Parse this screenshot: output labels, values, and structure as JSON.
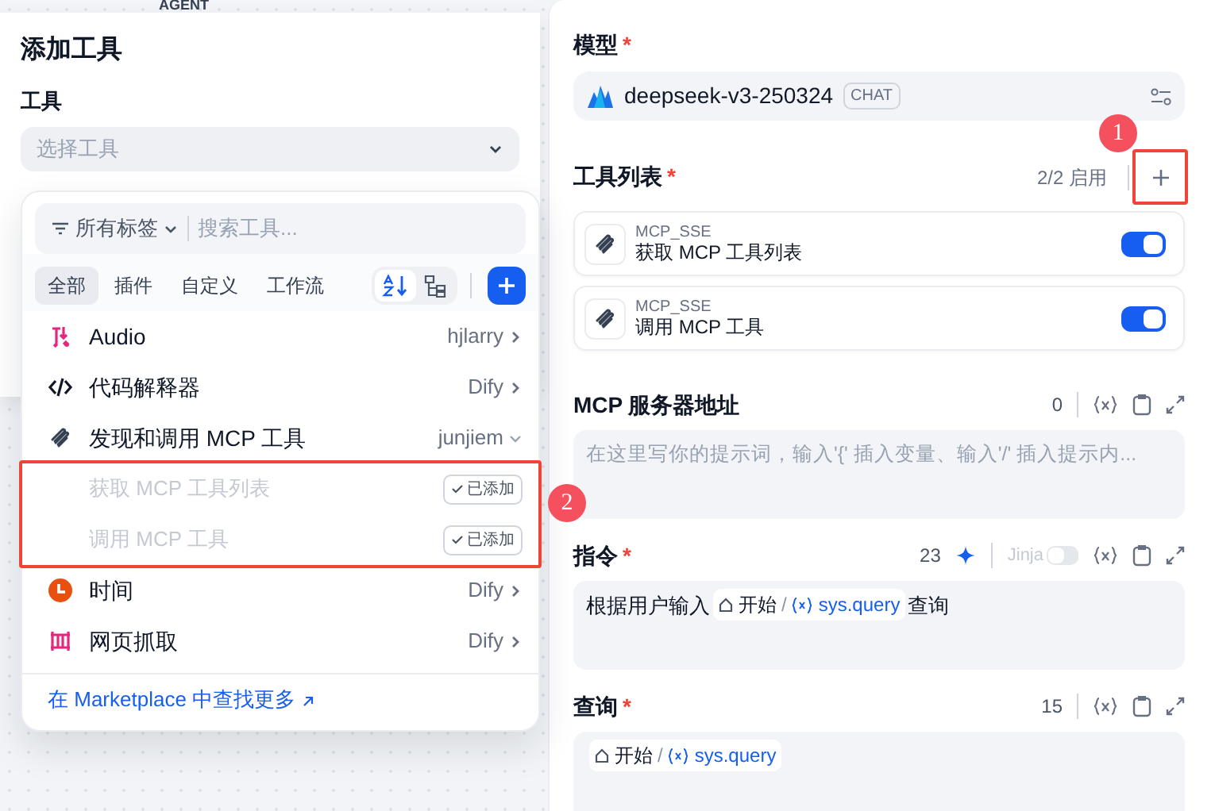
{
  "background_node": {
    "title": "AGENT"
  },
  "add_tool_panel": {
    "title": "添加工具",
    "field_label": "工具",
    "select": {
      "placeholder": "选择工具"
    },
    "dropdown": {
      "tag_filter": "所有标签",
      "search": {
        "placeholder": "搜索工具..."
      },
      "tabs": [
        {
          "label": "全部",
          "selected": true
        },
        {
          "label": "插件",
          "selected": false
        },
        {
          "label": "自定义",
          "selected": false
        },
        {
          "label": "工作流",
          "selected": false
        }
      ],
      "view_toggles": [
        {
          "kind": "sort",
          "selected": true
        },
        {
          "kind": "tree",
          "selected": false
        }
      ],
      "tools": [
        {
          "kind": "audio",
          "name": "Audio",
          "author": "hjlarry",
          "expanded": false
        },
        {
          "kind": "code",
          "name": "代码解释器",
          "author": "Dify",
          "expanded": false
        },
        {
          "kind": "mcp",
          "name": "发现和调用 MCP 工具",
          "author": "junjiem",
          "expanded": true,
          "children_annotation": "2",
          "children": [
            {
              "name": "获取 MCP 工具列表",
              "badge": "已添加",
              "added": true
            },
            {
              "name": "调用 MCP 工具",
              "badge": "已添加",
              "added": true
            }
          ]
        },
        {
          "kind": "clock",
          "name": "时间",
          "author": "Dify",
          "expanded": false
        },
        {
          "kind": "web",
          "name": "网页抓取",
          "author": "Dify",
          "expanded": false
        }
      ],
      "marketplace_link": "在 Marketplace 中查找更多"
    }
  },
  "settings_panel": {
    "model": {
      "label": "模型",
      "required_mark": "*",
      "name": "deepseek-v3-250324",
      "badge": "CHAT"
    },
    "tool_list": {
      "label": "工具列表",
      "required_mark": "*",
      "count": "2/2 启用",
      "add_button_annotation": "1",
      "tools": [
        {
          "provider": "MCP_SSE",
          "name": "获取 MCP 工具列表",
          "on": true
        },
        {
          "provider": "MCP_SSE",
          "name": "调用 MCP 工具",
          "on": true
        }
      ]
    },
    "fields": [
      {
        "label": "MCP 服务器地址",
        "count": "0",
        "placeholder": "在这里写你的提示词，输入'{' 插入变量、输入'/' 插入提示内..."
      },
      {
        "label": "指令",
        "required_mark": "*",
        "count": "23",
        "generate": true,
        "jinja": {
          "label": "Jinja",
          "on": false
        },
        "content": [
          {
            "kind": "text",
            "text": "根据用户输入"
          },
          {
            "kind": "var",
            "node": "开始",
            "separator": "/",
            "variable": "sys.query"
          },
          {
            "kind": "text",
            "text": "查询"
          }
        ]
      },
      {
        "label": "查询",
        "required_mark": "*",
        "count": "15",
        "content": [
          {
            "kind": "var",
            "node": "开始",
            "separator": "/",
            "variable": "sys.query"
          }
        ]
      }
    ]
  }
}
